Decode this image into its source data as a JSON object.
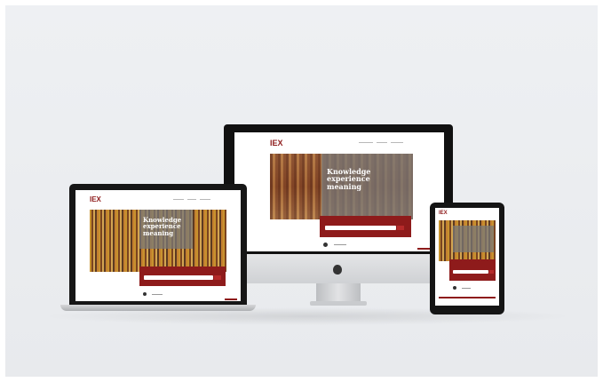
{
  "scene": {
    "background_color": "#eceef1",
    "accent_color": "#8e1b1b",
    "devices": [
      "laptop",
      "desktop-monitor",
      "tablet"
    ]
  },
  "site": {
    "logo_text": "IEX",
    "hero_lines_desktop": [
      "Knowledge",
      "experience",
      "meaning"
    ],
    "hero_lines_laptop": [
      "Knowledge",
      "experience",
      "meaning"
    ],
    "hero_lines_tablet": [
      "",
      "",
      ""
    ]
  },
  "monitor": {
    "brand_icon": "apple-icon"
  }
}
